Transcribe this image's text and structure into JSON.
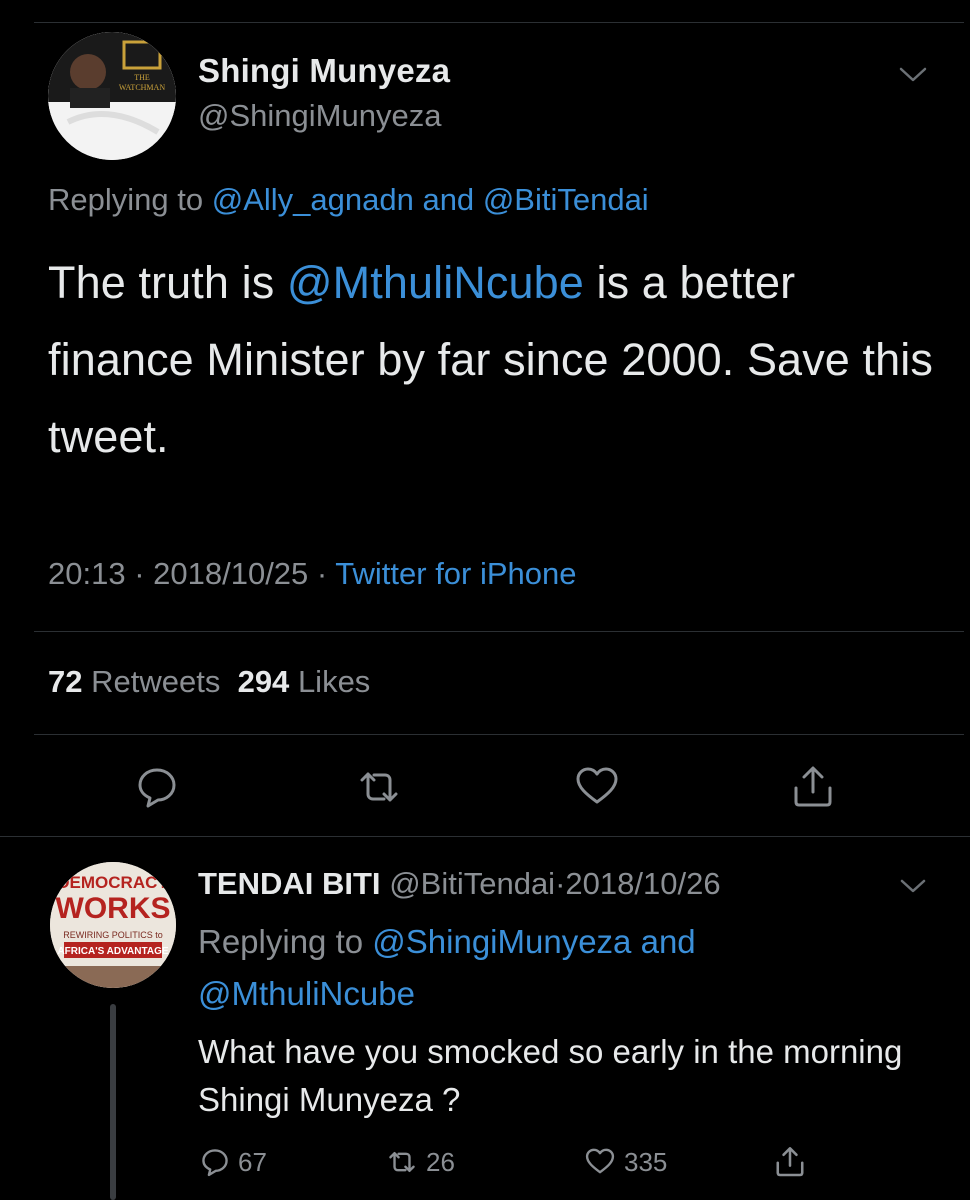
{
  "tweet": {
    "author_name": "Shingi Munyeza",
    "author_handle": "@ShingiMunyeza",
    "avatar_caption_1": "THE",
    "avatar_caption_2": "WATCHMAN",
    "reply_prefix": "Replying to",
    "reply_user_1": "@Ally_agnadn",
    "reply_and": "and",
    "reply_user_2": "@BitiTendai",
    "text_part1": "The truth is ",
    "text_mention": "@MthuliNcube",
    "text_part2": " is a better finance Minister by far since 2000. Save this tweet.",
    "time": "20:13",
    "sep1": " · ",
    "date": "2018/10/25",
    "sep2": " · ",
    "source": "Twitter for iPhone",
    "retweets_count": "72",
    "retweets_label": "Retweets",
    "likes_count": "294",
    "likes_label": "Likes"
  },
  "reply": {
    "author_name": "TENDAI BITI",
    "author_handle": "@BitiTendai",
    "sep": "·",
    "date": "2018/10/26",
    "avatar_line1": "DEMOCRACY",
    "avatar_line2": "WORKS",
    "avatar_line3": "REWIRING POLITICS to",
    "avatar_line4": "AFRICA'S ADVANTAGE",
    "reply_prefix": "Replying to",
    "reply_user_1": "@ShingiMunyeza",
    "reply_and": "and",
    "reply_user_2": "@MthuliNcube",
    "text": "What have you smocked so early in the morning Shingi Munyeza ?",
    "replies_count": "67",
    "retweets_count": "26",
    "likes_count": "335"
  },
  "colors": {
    "background": "#000000",
    "link": "#3b8fd8",
    "muted": "#8b8f94",
    "text": "#e7e9ea"
  }
}
